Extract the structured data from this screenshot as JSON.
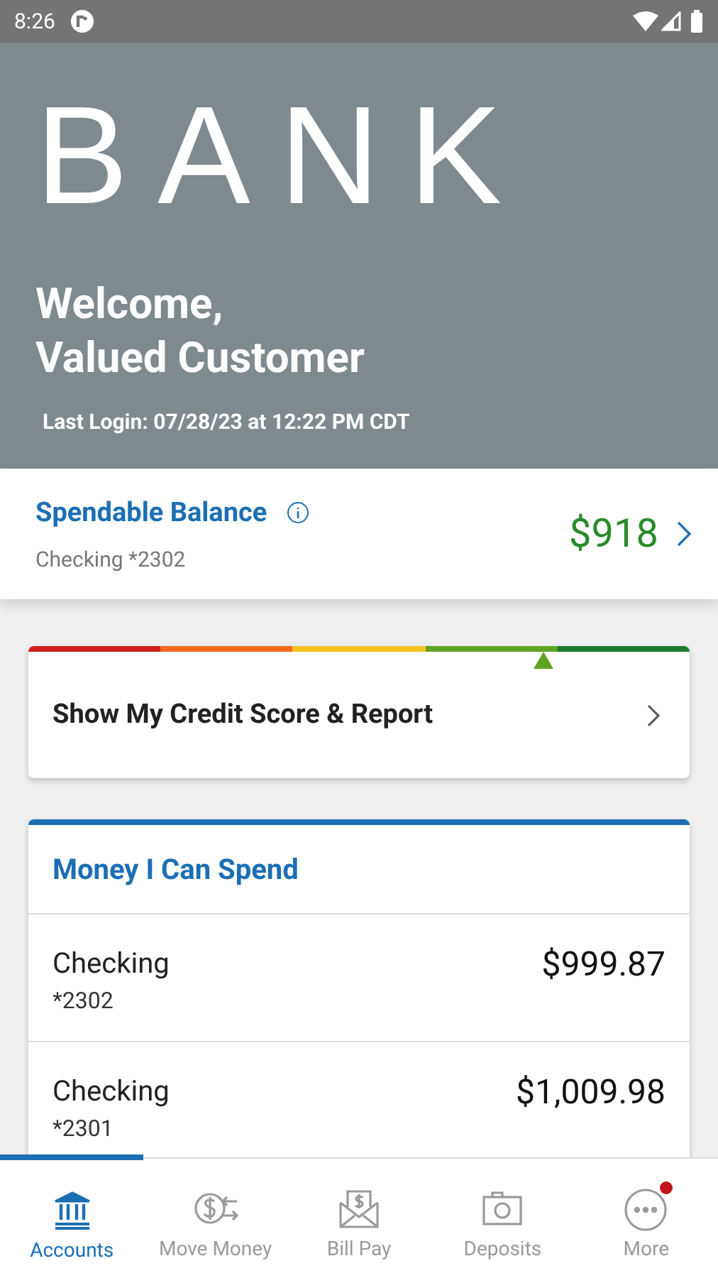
{
  "status_bar": {
    "time": "8:26"
  },
  "header": {
    "logo": "BANK",
    "welcome_lines": [
      "Welcome,",
      "Valued Customer"
    ],
    "last_login": "Last Login: 07/28/23 at 12:22 PM CDT"
  },
  "spendable": {
    "title": "Spendable Balance",
    "account": "Checking *2302",
    "amount": "$918"
  },
  "credit": {
    "label": "Show My Credit Score & Report",
    "level": 0.78,
    "segments": [
      {
        "color": "#d0201c"
      },
      {
        "color": "#ef6a1f"
      },
      {
        "color": "#f2c41d"
      },
      {
        "color": "#5ea321"
      },
      {
        "color": "#1f7a2e"
      }
    ]
  },
  "money_card": {
    "title": "Money I Can Spend",
    "accounts": [
      {
        "name": "Checking",
        "number": "*2302",
        "balance": "$999.87"
      },
      {
        "name": "Checking",
        "number": "*2301",
        "balance": "$1,009.98"
      }
    ]
  },
  "nav": [
    {
      "kind": "bank",
      "label": "Accounts",
      "selected": true,
      "badge": false
    },
    {
      "kind": "move",
      "label": "Move Money",
      "selected": false,
      "badge": false
    },
    {
      "kind": "bill",
      "label": "Bill Pay",
      "selected": false,
      "badge": false
    },
    {
      "kind": "camera",
      "label": "Deposits",
      "selected": false,
      "badge": false
    },
    {
      "kind": "more",
      "label": "More",
      "selected": false,
      "badge": true
    }
  ]
}
